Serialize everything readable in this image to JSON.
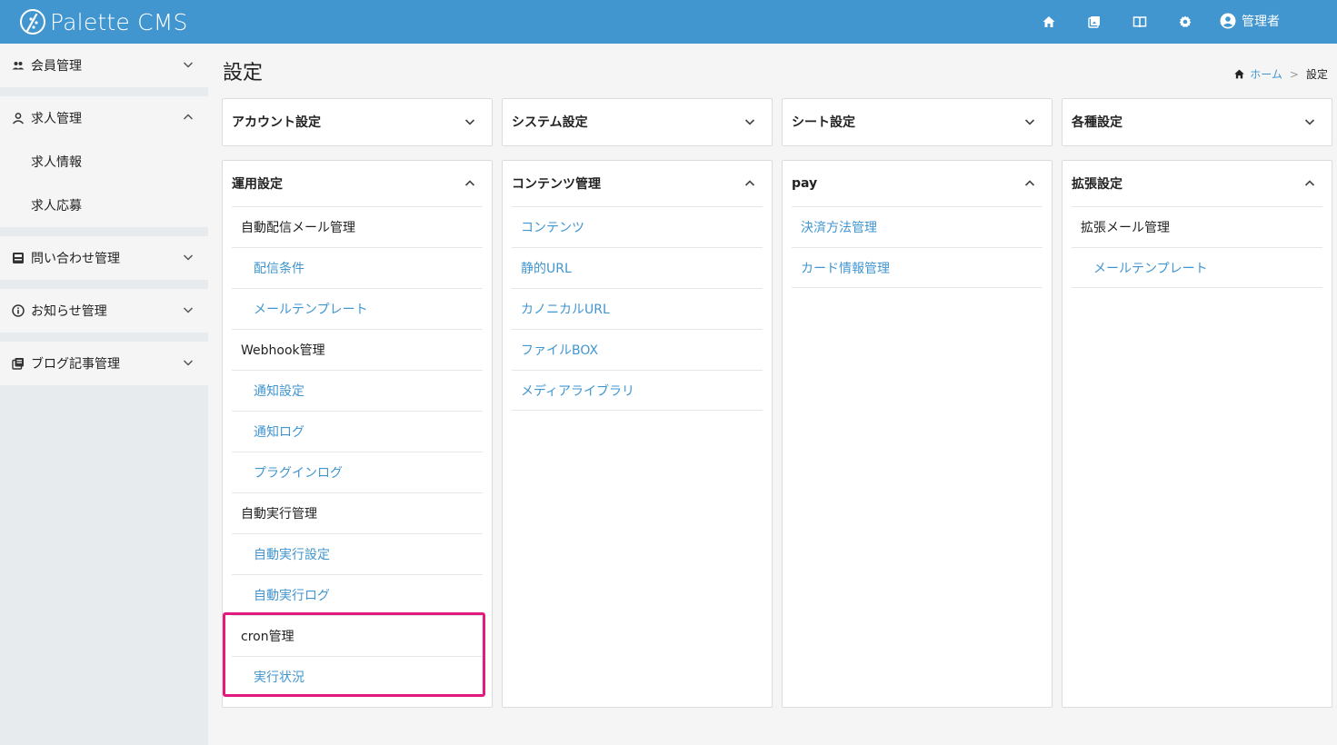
{
  "header": {
    "app_name": "Palette CMS",
    "user_label": "管理者",
    "accent_color": "#4196cf",
    "icons": [
      "home-icon",
      "image-icon",
      "book-icon",
      "gear-icon",
      "account-icon"
    ]
  },
  "sidebar": {
    "groups": [
      {
        "label": "会員管理",
        "icon": "people-icon",
        "expanded": false,
        "items": []
      },
      {
        "label": "求人管理",
        "icon": "person-icon",
        "expanded": true,
        "items": [
          {
            "label": "求人情報"
          },
          {
            "label": "求人応募"
          }
        ]
      },
      {
        "label": "問い合わせ管理",
        "icon": "inbox-icon",
        "expanded": false,
        "items": []
      },
      {
        "label": "お知らせ管理",
        "icon": "info-icon",
        "expanded": false,
        "items": []
      },
      {
        "label": "ブログ記事管理",
        "icon": "library-icon",
        "expanded": false,
        "items": []
      }
    ]
  },
  "page": {
    "title": "設定",
    "breadcrumb": {
      "home": "ホーム",
      "separator": ">",
      "current": "設定"
    }
  },
  "cards_top": [
    {
      "title": "アカウント設定",
      "expanded": false
    },
    {
      "title": "システム設定",
      "expanded": false
    },
    {
      "title": "シート設定",
      "expanded": false
    },
    {
      "title": "各種設定",
      "expanded": false
    }
  ],
  "cards_bottom": [
    {
      "title": "運用設定",
      "items": [
        {
          "label": "自動配信メール管理",
          "level": 1
        },
        {
          "label": "配信条件",
          "level": 2
        },
        {
          "label": "メールテンプレート",
          "level": 2
        },
        {
          "label": "Webhook管理",
          "level": 1
        },
        {
          "label": "通知設定",
          "level": 2
        },
        {
          "label": "通知ログ",
          "level": 2
        },
        {
          "label": "プラグインログ",
          "level": 2
        },
        {
          "label": "自動実行管理",
          "level": 1
        },
        {
          "label": "自動実行設定",
          "level": 2
        },
        {
          "label": "自動実行ログ",
          "level": 2
        },
        {
          "label": "cron管理",
          "level": 1
        },
        {
          "label": "実行状況",
          "level": 2
        }
      ]
    },
    {
      "title": "コンテンツ管理",
      "items": [
        {
          "label": "コンテンツ",
          "level": 0
        },
        {
          "label": "静的URL",
          "level": 0
        },
        {
          "label": "カノニカルURL",
          "level": 0
        },
        {
          "label": "ファイルBOX",
          "level": 0
        },
        {
          "label": "メディアライブラリ",
          "level": 0
        }
      ]
    },
    {
      "title": "pay",
      "items": [
        {
          "label": "決済方法管理",
          "level": 0
        },
        {
          "label": "カード情報管理",
          "level": 0
        }
      ]
    },
    {
      "title": "拡張設定",
      "items": [
        {
          "label": "拡張メール管理",
          "level": 1
        },
        {
          "label": "メールテンプレート",
          "level": 2
        }
      ]
    }
  ]
}
